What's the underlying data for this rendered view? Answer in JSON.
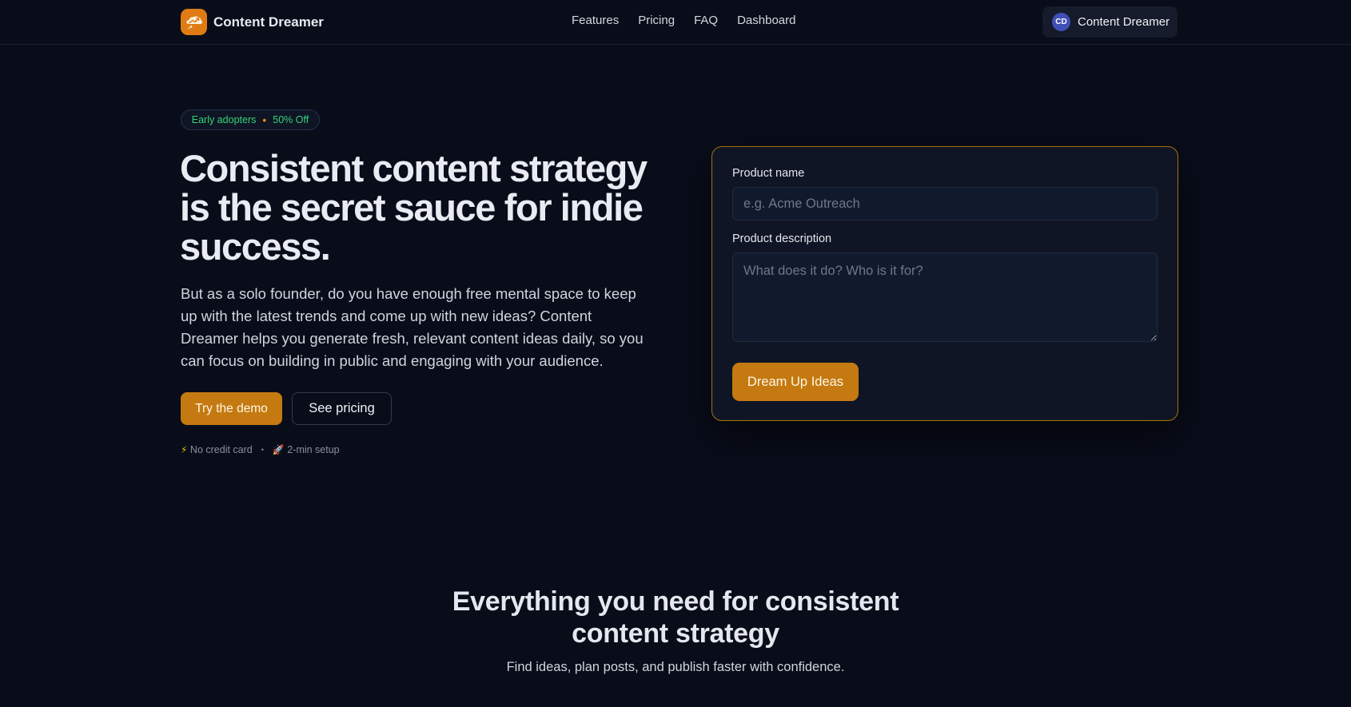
{
  "header": {
    "brand_name": "Content Dreamer",
    "nav": [
      "Features",
      "Pricing",
      "FAQ",
      "Dashboard"
    ],
    "account": {
      "initials": "CD",
      "name": "Content Dreamer"
    }
  },
  "hero": {
    "badge": {
      "left": "Early adopters",
      "separator": "•",
      "right": "50% Off"
    },
    "title": "Consistent content strategy is the secret sauce for indie success.",
    "description": "But as a solo founder, do you have enough free mental space to keep up with the latest trends and come up with new ideas? Content Dreamer helps you generate fresh, relevant content ideas daily, so you can focus on building in public and engaging with your audience.",
    "primary_cta": "Try the demo",
    "secondary_cta": "See pricing",
    "perks": [
      {
        "icon": "⚡",
        "text": "No credit card"
      },
      {
        "icon": "🚀",
        "text": "2-min setup"
      }
    ],
    "perk_separator": "•"
  },
  "form": {
    "product_name_label": "Product name",
    "product_name_placeholder": "e.g. Acme Outreach",
    "product_name_value": "",
    "description_label": "Product description",
    "description_placeholder": "What does it do? Who is it for?",
    "description_value": "",
    "submit_label": "Dream Up Ideas"
  },
  "features": {
    "title_line1": "Everything you need for consistent",
    "title_line2": "content strategy",
    "subtitle": "Find ideas, plan posts, and publish faster with confidence."
  },
  "colors": {
    "background": "#090d1a",
    "accent": "#c47a10",
    "badge_text": "#34d27a",
    "card_border": "#a8700f"
  }
}
